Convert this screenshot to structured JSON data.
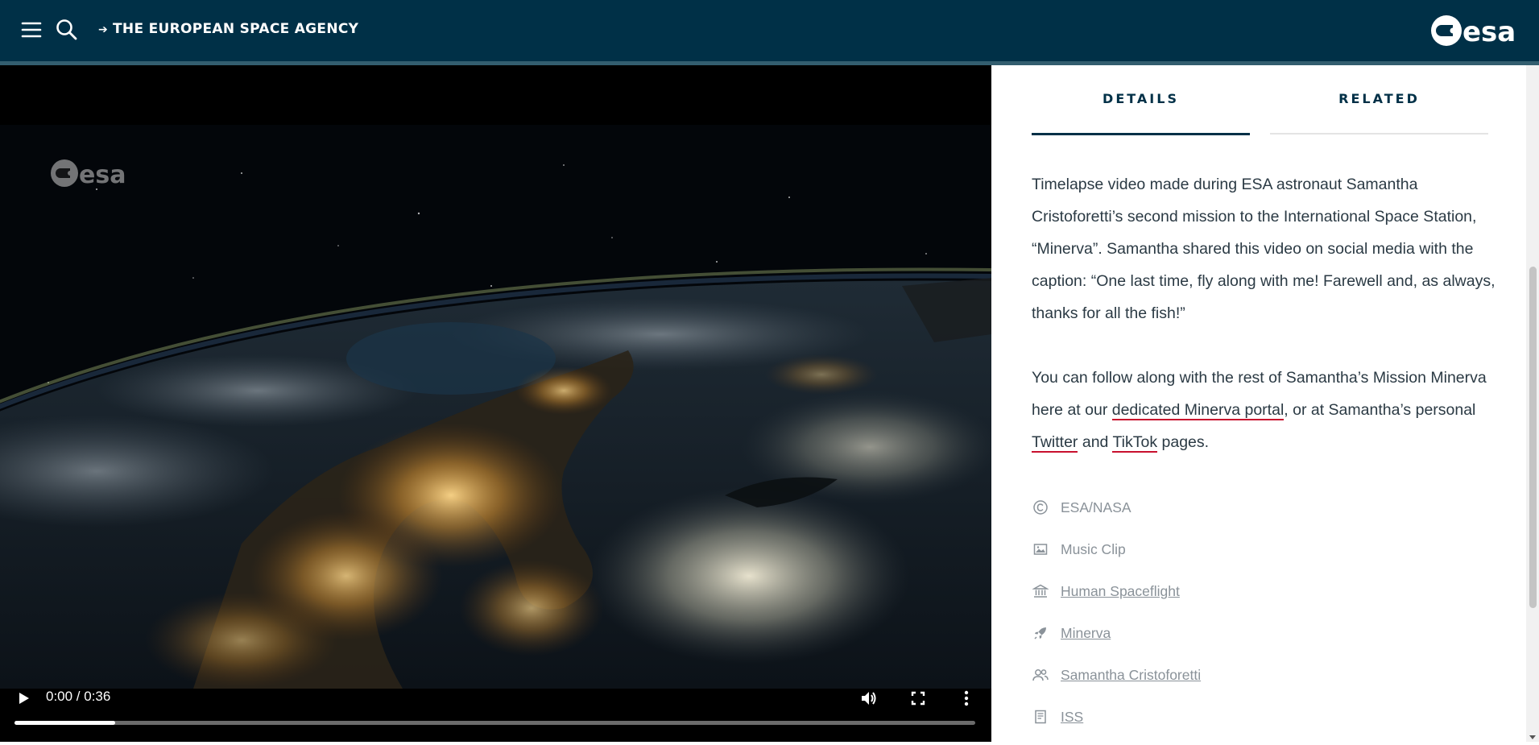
{
  "header": {
    "agency_label": "THE EUROPEAN SPACE AGENCY",
    "brand_color": "#003047",
    "icons": {
      "menu": "hamburger-menu-icon",
      "search": "search-icon",
      "link": "arrow-right-icon",
      "logo": "esa-logo"
    }
  },
  "video": {
    "time_display": "0:00 / 0:36",
    "progress": 0.105,
    "icons": {
      "play": "play-icon",
      "volume": "volume-icon",
      "fullscreen": "fullscreen-icon",
      "more": "more-options-icon"
    }
  },
  "tabs": [
    {
      "label": "DETAILS",
      "active": true
    },
    {
      "label": "RELATED",
      "active": false
    }
  ],
  "description": {
    "paragraph1": "Timelapse video made during ESA astronaut Samantha Cristoforetti’s second mission to the International Space Station, “Minerva”. Samantha shared this video on social media with the caption: “One last time, fly along with me! Farewell and, as always, thanks for all the fish!”",
    "paragraph2_start": "You can follow along with the rest of Samantha’s Mission Minerva here at our ",
    "link_portal": "dedicated Minerva portal",
    "paragraph2_mid": ", or at Samantha’s personal ",
    "link_twitter": "Twitter",
    "paragraph2_and": " and ",
    "link_tiktok": "TikTok",
    "paragraph2_end": " pages.",
    "link_underline_color": "#c8102e"
  },
  "meta": {
    "copyright": {
      "label": "ESA/NASA",
      "icon": "copyright-icon"
    },
    "type": {
      "label": "Music Clip",
      "icon": "image-icon"
    },
    "activity": {
      "label": "Human Spaceflight",
      "icon": "institution-icon"
    },
    "mission": {
      "label": "Minerva",
      "icon": "rocket-icon"
    },
    "people": {
      "label": "Samantha Cristoforetti",
      "icon": "people-icon"
    },
    "system": {
      "label": "ISS",
      "icon": "book-icon"
    }
  }
}
